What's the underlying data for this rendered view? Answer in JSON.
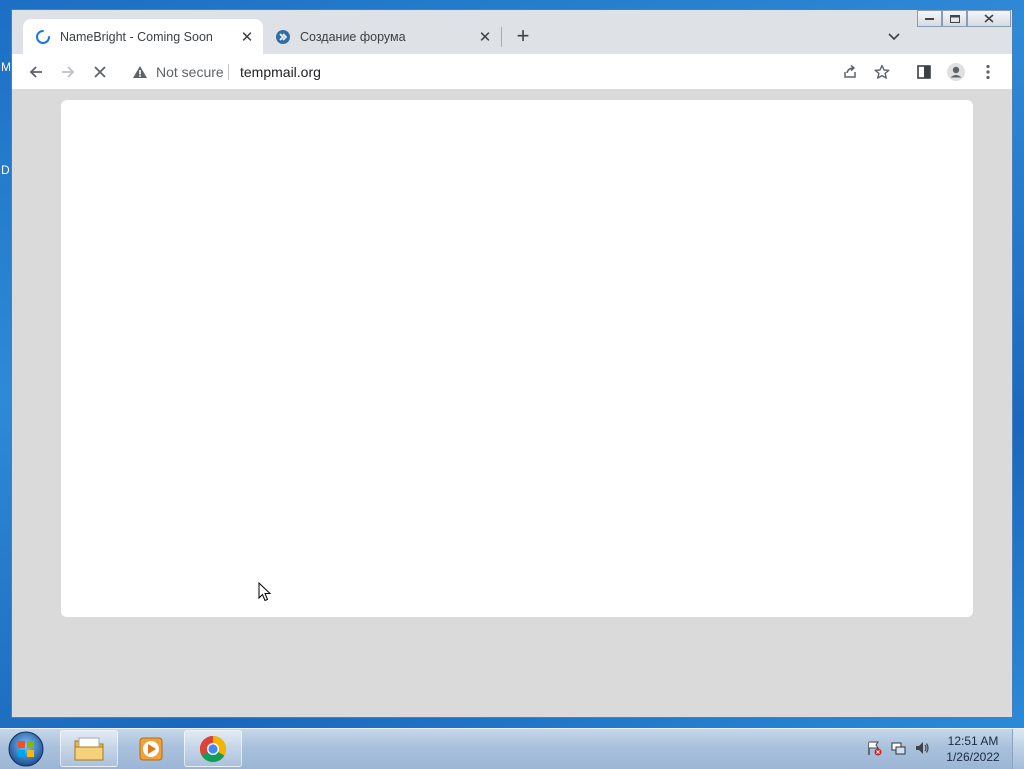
{
  "desktop": {
    "edge_letters": [
      "M",
      "D"
    ]
  },
  "browser": {
    "tabs": [
      {
        "title": "NameBright - Coming Soon",
        "active": true,
        "loading": true,
        "close": "✕"
      },
      {
        "title": "Создание форума",
        "active": false,
        "close": "✕"
      }
    ],
    "new_tab": "+",
    "address": {
      "security_label": "Not secure",
      "url": "tempmail.org"
    },
    "icons": {
      "back": "back-arrow-icon",
      "forward": "forward-arrow-icon",
      "stop": "stop-loading-icon",
      "share": "share-icon",
      "bookmark": "star-icon",
      "side_panel": "side-panel-icon",
      "profile": "profile-icon",
      "menu": "kebab-menu-icon"
    }
  },
  "taskbar": {
    "time": "12:51 AM",
    "date": "1/26/2022"
  },
  "colors": {
    "taskbar": "#a9c1dc",
    "page_bg": "#dadada",
    "loader": "#1a73e8"
  }
}
